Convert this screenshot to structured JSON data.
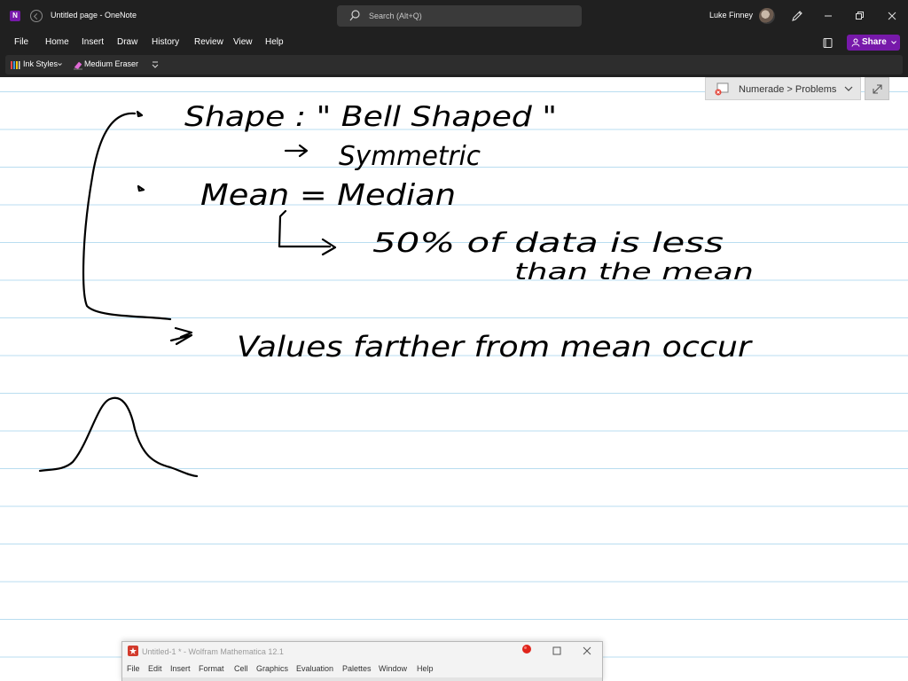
{
  "titlebar": {
    "window_title": "Untitled page - OneNote",
    "search_placeholder": "Search (Alt+Q)",
    "user_name": "Luke Finney",
    "app_logo_letter": "N"
  },
  "menubar": {
    "items": [
      "File",
      "Home",
      "Insert",
      "Draw",
      "History",
      "Review",
      "View",
      "Help"
    ],
    "share_label": "Share"
  },
  "toolbar": {
    "ink_styles_label": "Ink Styles",
    "eraser_label": "Medium Eraser"
  },
  "numerade": {
    "label": "Numerade > Problems"
  },
  "ink_text": [
    "Shape : \" Bell Shaped \"",
    "Symmetric",
    "Mean = Median",
    "50% of data is less",
    "than the mean",
    "Values farther from mean occur"
  ],
  "mathematica": {
    "title": "Untitled-1 * - Wolfram Mathematica 12.1",
    "menu": [
      "File",
      "Edit",
      "Insert",
      "Format",
      "Cell",
      "Graphics",
      "Evaluation",
      "Palettes",
      "Window",
      "Help"
    ]
  },
  "colors": {
    "titlebar_bg": "#202020",
    "accent": "#7719aa",
    "rule_line": "#b9ddf0",
    "ink": "#000000"
  }
}
